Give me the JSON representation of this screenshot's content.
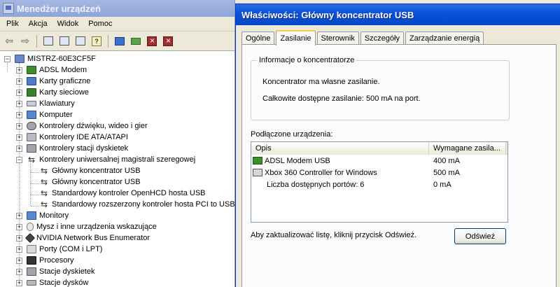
{
  "device_manager": {
    "title": "Menedżer urządzeń",
    "menu": [
      "Plik",
      "Akcja",
      "Widok",
      "Pomoc"
    ],
    "root": "MISTRZ-60E3CF5F",
    "categories": [
      "ADSL Modem",
      "Karty graficzne",
      "Karty sieciowe",
      "Klawiatury",
      "Komputer",
      "Kontrolery dźwięku, wideo i gier",
      "Kontrolery IDE ATA/ATAPI",
      "Kontrolery stacji dyskietek",
      "Kontrolery uniwersalnej magistrali szeregowej"
    ],
    "usb_children": [
      "Główny koncentrator USB",
      "Główny koncentrator USB",
      "Standardowy kontroler OpenHCD hosta USB",
      "Standardowy rozszerzony kontroler hosta PCI to USB"
    ],
    "categories_after": [
      "Monitory",
      "Mysz i inne urządzenia wskazujące",
      "NVIDIA Network Bus Enumerator",
      "Porty (COM i LPT)",
      "Procesory",
      "Stacje dyskietek",
      "Stacje dysków"
    ]
  },
  "properties": {
    "title": "Właściwości: Główny koncentrator USB",
    "tabs": [
      "Ogólne",
      "Zasilanie",
      "Sterownik",
      "Szczegóły",
      "Zarządzanie energią"
    ],
    "active_tab": "Zasilanie",
    "hub_info": {
      "label": "Informacje o koncentratorze",
      "line1": "Koncentrator ma własne zasilanie.",
      "line2": "Całkowite dostępne zasilanie:  500 mA na port."
    },
    "connected_label": "Podłączone urządzenia:",
    "columns": [
      "Opis",
      "Wymagane zasila..."
    ],
    "rows": [
      {
        "desc": "ADSL Modem USB",
        "power": "400 mA"
      },
      {
        "desc": "Xbox 360 Controller for Windows",
        "power": "500 mA"
      },
      {
        "desc": "Liczba dostępnych portów: 6",
        "power": "0 mA"
      }
    ],
    "hint": "Aby zaktualizować listę, kliknij przycisk Odśwież.",
    "refresh_button": "Odśwież"
  }
}
